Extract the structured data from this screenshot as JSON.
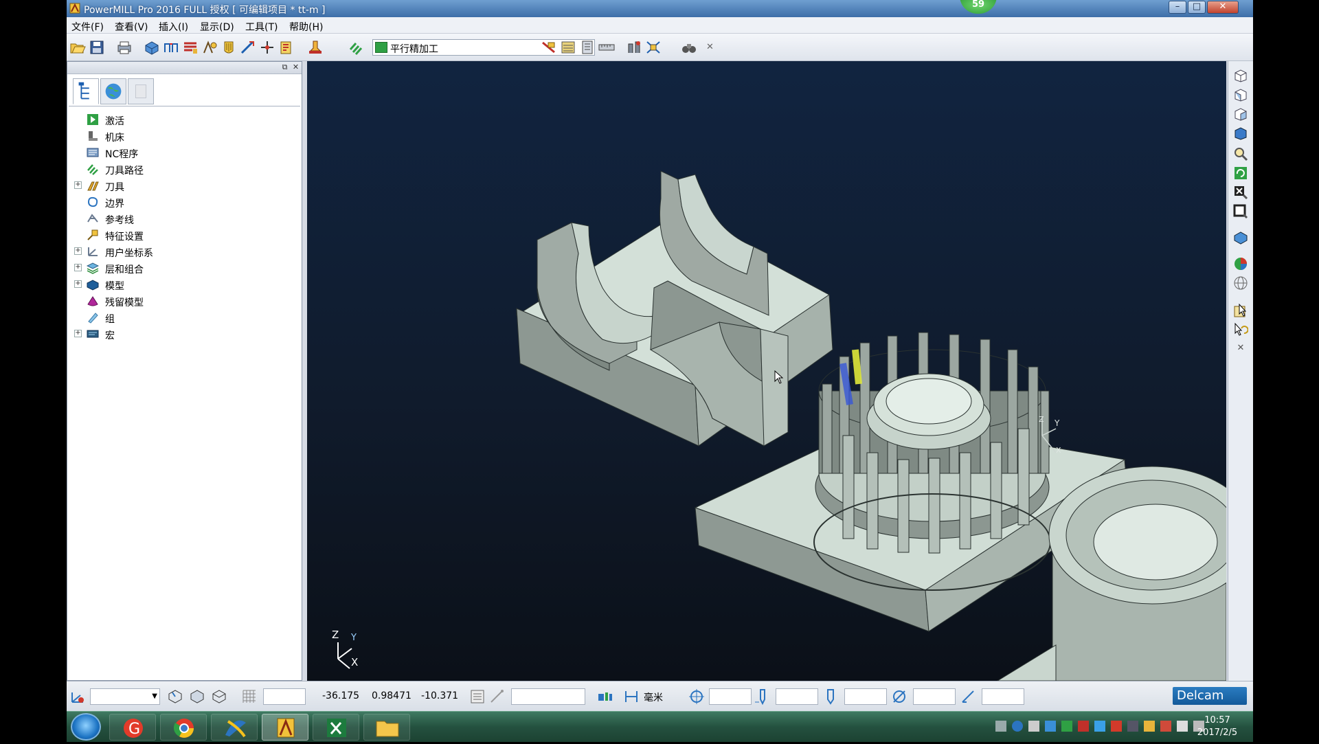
{
  "window": {
    "title": "PowerMILL Pro 2016 FULL 授权    [ 可编辑项目 * tt-m ]",
    "badge": "59",
    "minimize": "–",
    "maximize": "□",
    "close": "✕"
  },
  "menu": [
    "文件(F)",
    "查看(V)",
    "插入(I)",
    "显示(D)",
    "工具(T)",
    "帮助(H)"
  ],
  "toolbar": {
    "strategy_combo": "平行精加工",
    "combo_arrow": "▼",
    "close": "✕"
  },
  "panel": {
    "float_btn": "⧉",
    "close_btn": "✕",
    "tree": [
      {
        "label": "激活",
        "icon": "activate-icon",
        "expandable": false
      },
      {
        "label": "机床",
        "icon": "machine-icon",
        "expandable": false
      },
      {
        "label": "NC程序",
        "icon": "nc-program-icon",
        "expandable": false
      },
      {
        "label": "刀具路径",
        "icon": "toolpath-icon",
        "expandable": false
      },
      {
        "label": "刀具",
        "icon": "tool-icon",
        "expandable": true
      },
      {
        "label": "边界",
        "icon": "boundary-icon",
        "expandable": false
      },
      {
        "label": "参考线",
        "icon": "pattern-icon",
        "expandable": false
      },
      {
        "label": "特征设置",
        "icon": "featureset-icon",
        "expandable": false
      },
      {
        "label": "用户坐标系",
        "icon": "workplane-icon",
        "expandable": true
      },
      {
        "label": "层和组合",
        "icon": "levels-icon",
        "expandable": true
      },
      {
        "label": "模型",
        "icon": "model-icon",
        "expandable": true
      },
      {
        "label": "残留模型",
        "icon": "stock-model-icon",
        "expandable": false
      },
      {
        "label": "组",
        "icon": "group-icon",
        "expandable": false
      },
      {
        "label": "宏",
        "icon": "macro-icon",
        "expandable": true
      }
    ],
    "expand_glyph": "+"
  },
  "viewport": {
    "axis_z": "Z",
    "axis_y": "Y",
    "axis_x": "X"
  },
  "status": {
    "x": "-36.175",
    "y": "0.98471",
    "z": "-10.371",
    "unit": "毫米",
    "brand": "Delcam"
  },
  "taskbar": {
    "time": "10:57",
    "date": "2017/2/5"
  }
}
